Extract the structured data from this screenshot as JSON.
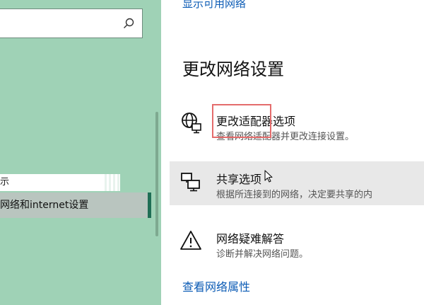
{
  "search": {
    "placeholder": "",
    "value": ""
  },
  "sidebar": {
    "items": [
      {
        "label": "示"
      },
      {
        "label": "网络和internet设置"
      }
    ]
  },
  "main": {
    "top_link": "显示可用网络",
    "section_title": "更改网络设置",
    "options": [
      {
        "title": "更改适配器选项",
        "desc": "查看网络适配器并更改连接设置。"
      },
      {
        "title": "共享选项",
        "desc": "根据所连接到的网络，决定要共享的内"
      },
      {
        "title": "网络疑难解答",
        "desc": "诊断并解决网络问题。"
      }
    ],
    "bottom_link": "查看网络属性"
  },
  "colors": {
    "sidebar_bg": "#9fd2b6",
    "link": "#0b5bb5",
    "selected_indicator": "#1f6e55",
    "annotation_box": "#e46c6c"
  },
  "icons": [
    "search-icon",
    "globe-pc-icon",
    "sharing-icon",
    "warning-icon",
    "cursor-icon"
  ]
}
